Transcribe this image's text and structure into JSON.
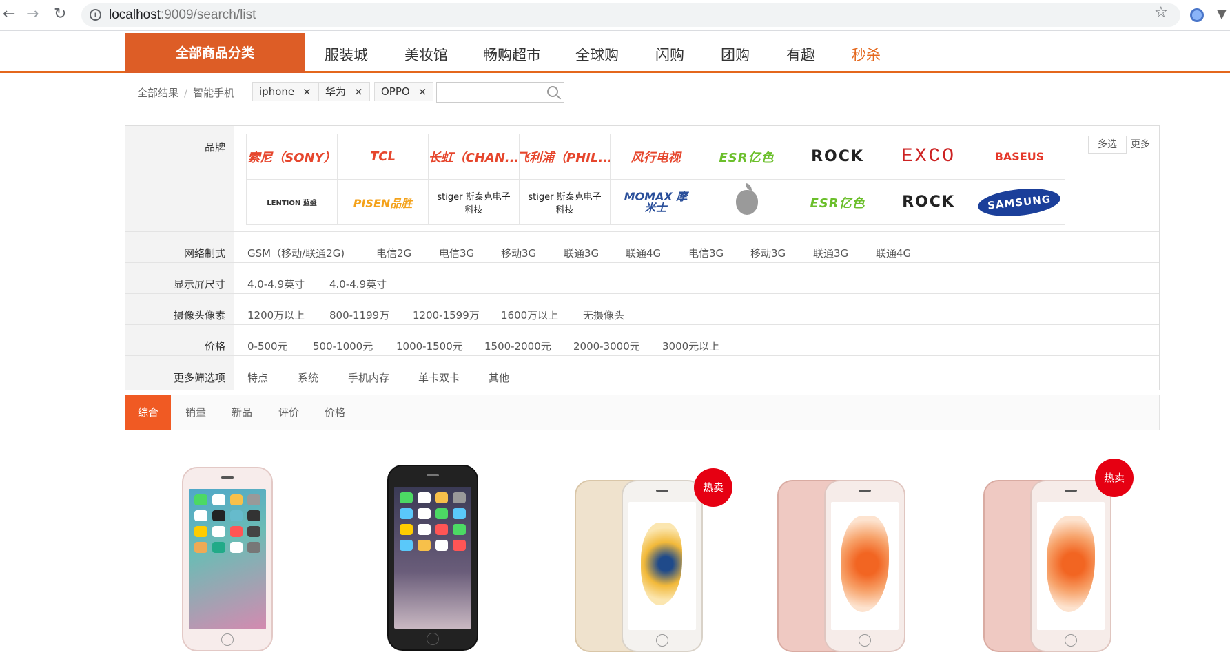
{
  "browser": {
    "url_host": "localhost",
    "url_rest": ":9009/search/list"
  },
  "topnav": {
    "all_categories": "全部商品分类",
    "items": [
      "服装城",
      "美妆馆",
      "畅购超市",
      "全球购",
      "闪购",
      "团购",
      "有趣",
      "秒杀"
    ],
    "hot_index": 7
  },
  "breadcrumb": {
    "all_results": "全部结果",
    "separator": "/",
    "category": "智能手机",
    "tags": [
      "iphone",
      "华为",
      "OPPO"
    ],
    "tag_close": "×"
  },
  "search": {
    "value": "",
    "placeholder": ""
  },
  "filters": {
    "brand_label": "品牌",
    "brands_row1": [
      "索尼（SONY）",
      "TCL",
      "长虹（CHAN...",
      "飞利浦（PHIL...",
      "风行电视",
      "ESR亿色",
      "ROCK",
      "EXCO",
      "BASEUS"
    ],
    "brands_row2": [
      "LENTION 蓝盛",
      "PISEN品胜",
      "stiger 斯泰克电子科技",
      "stiger 斯泰克电子科技",
      "MOMAX 摩米士",
      "apple-logo",
      "ESR亿色",
      "ROCK",
      "SAMSUNG"
    ],
    "multi_select": "多选",
    "more": "更多",
    "rows": [
      {
        "label": "网络制式",
        "options": [
          "GSM（移动/联通2G)",
          "电信2G",
          "电信3G",
          "移动3G",
          "联通3G",
          "联通4G",
          "电信3G",
          "移动3G",
          "联通3G",
          "联通4G"
        ]
      },
      {
        "label": "显示屏尺寸",
        "options": [
          "4.0-4.9英寸",
          "4.0-4.9英寸"
        ]
      },
      {
        "label": "摄像头像素",
        "options": [
          "1200万以上",
          "800-1199万",
          "1200-1599万",
          "1600万以上",
          "无摄像头"
        ]
      },
      {
        "label": "价格",
        "options": [
          "0-500元",
          "500-1000元",
          "1000-1500元",
          "1500-2000元",
          "2000-3000元",
          "3000元以上"
        ]
      },
      {
        "label": "更多筛选项",
        "options": [
          "特点",
          "系统",
          "手机内存",
          "单卡双卡",
          "其他"
        ]
      }
    ]
  },
  "sort": {
    "items": [
      "综合",
      "销量",
      "新品",
      "评价",
      "价格"
    ],
    "active_index": 0
  },
  "products": [
    {
      "color": "rose-white",
      "badge": ""
    },
    {
      "color": "space-gray",
      "badge": ""
    },
    {
      "color": "gold",
      "badge": "热卖"
    },
    {
      "color": "rose-gold",
      "badge": ""
    },
    {
      "color": "rose-gold",
      "badge": "热卖"
    }
  ],
  "colors": {
    "accent": "#e4671c",
    "all_cat_bg": "#dd5d26",
    "sort_active": "#f05a23",
    "hot_badge": "#e60012"
  }
}
